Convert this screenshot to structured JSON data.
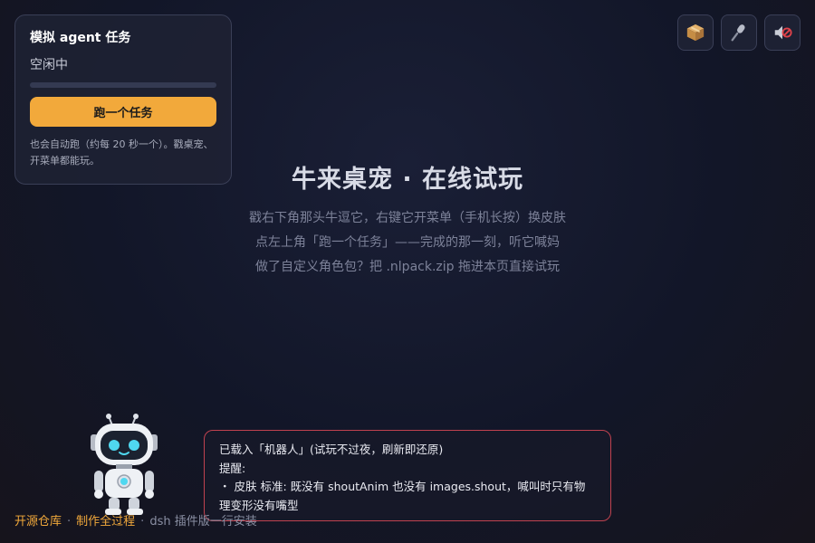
{
  "task_card": {
    "title": "模拟 agent 任务",
    "status": "空闲中",
    "progress": 0,
    "run_button": "跑一个任务",
    "hint": "也会自动跑（约每 20 秒一个）。戳桌宠、开菜单都能玩。"
  },
  "top_buttons": [
    {
      "icon": "package-icon"
    },
    {
      "icon": "microphone-icon"
    },
    {
      "icon": "mute-icon"
    }
  ],
  "hero": {
    "title": "牛来桌宠 · 在线试玩",
    "line1": "戳右下角那头牛逗它，右键它开菜单（手机长按）换皮肤",
    "line2": "点左上角「跑一个任务」——完成的那一刻，听它喊妈",
    "line3": "做了自定义角色包？把 .nlpack.zip 拖进本页直接试玩"
  },
  "toast": {
    "line1": "已载入「机器人」(试玩不过夜，刷新即还原)",
    "line2": "提醒:",
    "line3": "・ 皮肤 标准: 既没有 shoutAnim 也没有 images.shout，喊叫时只有物理变形没有嘴型"
  },
  "footer": {
    "link_repo": "开源仓库",
    "link_process": "制作全过程",
    "sep": "·",
    "text_plugin": "dsh 插件版一行安装"
  },
  "colors": {
    "accent": "#f2a93b",
    "toast_border": "#c0424f"
  }
}
